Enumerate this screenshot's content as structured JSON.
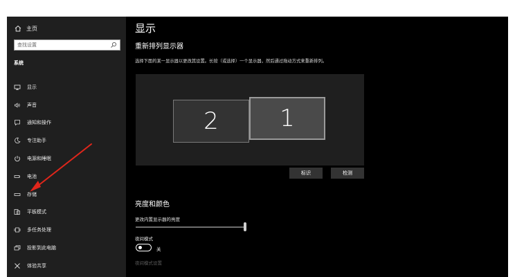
{
  "sidebar": {
    "home_label": "主页",
    "search_placeholder": "查找设置",
    "section_label": "系统",
    "items": [
      {
        "label": "显示",
        "icon": "monitor-icon"
      },
      {
        "label": "声音",
        "icon": "speaker-icon"
      },
      {
        "label": "通知和操作",
        "icon": "notification-icon"
      },
      {
        "label": "专注助手",
        "icon": "moon-icon"
      },
      {
        "label": "电源和睡眠",
        "icon": "power-icon"
      },
      {
        "label": "电池",
        "icon": "battery-icon"
      },
      {
        "label": "存储",
        "icon": "storage-icon"
      },
      {
        "label": "平板模式",
        "icon": "tablet-icon"
      },
      {
        "label": "多任务处理",
        "icon": "multitask-icon"
      },
      {
        "label": "投影到此电脑",
        "icon": "project-icon"
      },
      {
        "label": "体验共享",
        "icon": "share-icon"
      }
    ]
  },
  "main": {
    "title": "显示",
    "subtitle": "重新排列显示器",
    "description": "选择下面的某一显示器以更改其设置。长按（或选择）一个显示器，然后通过拖动方式来重新排列。",
    "monitors": [
      {
        "number": "2"
      },
      {
        "number": "1"
      }
    ],
    "identify_label": "标识",
    "detect_label": "检测",
    "brightness_section": "亮度和颜色",
    "brightness_label": "更改内置显示器的亮度",
    "brightness_value": 0.97,
    "night_mode_label": "夜间模式",
    "night_mode_state": "关",
    "night_mode_settings": "夜间模式设置"
  },
  "colors": {
    "sidebar_bg": "#1f1f1f",
    "main_bg": "#000000",
    "canvas_bg": "#1f1f1f",
    "annotation_arrow": "#e0261b"
  }
}
